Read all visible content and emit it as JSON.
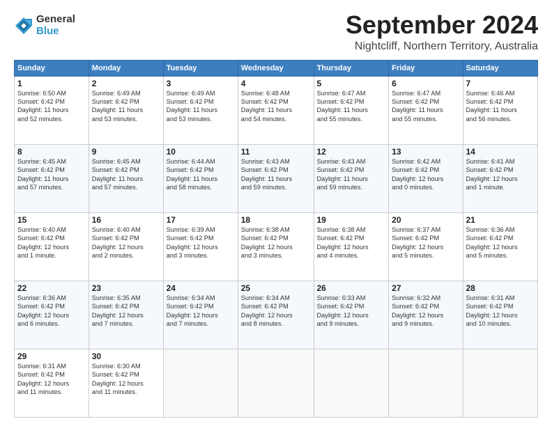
{
  "header": {
    "logo_general": "General",
    "logo_blue": "Blue",
    "month": "September 2024",
    "location": "Nightcliff, Northern Territory, Australia"
  },
  "calendar": {
    "days_of_week": [
      "Sunday",
      "Monday",
      "Tuesday",
      "Wednesday",
      "Thursday",
      "Friday",
      "Saturday"
    ],
    "weeks": [
      [
        {
          "day": "1",
          "info": "Sunrise: 6:50 AM\nSunset: 6:42 PM\nDaylight: 11 hours\nand 52 minutes."
        },
        {
          "day": "2",
          "info": "Sunrise: 6:49 AM\nSunset: 6:42 PM\nDaylight: 11 hours\nand 53 minutes."
        },
        {
          "day": "3",
          "info": "Sunrise: 6:49 AM\nSunset: 6:42 PM\nDaylight: 11 hours\nand 53 minutes."
        },
        {
          "day": "4",
          "info": "Sunrise: 6:48 AM\nSunset: 6:42 PM\nDaylight: 11 hours\nand 54 minutes."
        },
        {
          "day": "5",
          "info": "Sunrise: 6:47 AM\nSunset: 6:42 PM\nDaylight: 11 hours\nand 55 minutes."
        },
        {
          "day": "6",
          "info": "Sunrise: 6:47 AM\nSunset: 6:42 PM\nDaylight: 11 hours\nand 55 minutes."
        },
        {
          "day": "7",
          "info": "Sunrise: 6:46 AM\nSunset: 6:42 PM\nDaylight: 11 hours\nand 56 minutes."
        }
      ],
      [
        {
          "day": "8",
          "info": "Sunrise: 6:45 AM\nSunset: 6:42 PM\nDaylight: 11 hours\nand 57 minutes."
        },
        {
          "day": "9",
          "info": "Sunrise: 6:45 AM\nSunset: 6:42 PM\nDaylight: 11 hours\nand 57 minutes."
        },
        {
          "day": "10",
          "info": "Sunrise: 6:44 AM\nSunset: 6:42 PM\nDaylight: 11 hours\nand 58 minutes."
        },
        {
          "day": "11",
          "info": "Sunrise: 6:43 AM\nSunset: 6:42 PM\nDaylight: 11 hours\nand 59 minutes."
        },
        {
          "day": "12",
          "info": "Sunrise: 6:43 AM\nSunset: 6:42 PM\nDaylight: 11 hours\nand 59 minutes."
        },
        {
          "day": "13",
          "info": "Sunrise: 6:42 AM\nSunset: 6:42 PM\nDaylight: 12 hours\nand 0 minutes."
        },
        {
          "day": "14",
          "info": "Sunrise: 6:41 AM\nSunset: 6:42 PM\nDaylight: 12 hours\nand 1 minute."
        }
      ],
      [
        {
          "day": "15",
          "info": "Sunrise: 6:40 AM\nSunset: 6:42 PM\nDaylight: 12 hours\nand 1 minute."
        },
        {
          "day": "16",
          "info": "Sunrise: 6:40 AM\nSunset: 6:42 PM\nDaylight: 12 hours\nand 2 minutes."
        },
        {
          "day": "17",
          "info": "Sunrise: 6:39 AM\nSunset: 6:42 PM\nDaylight: 12 hours\nand 3 minutes."
        },
        {
          "day": "18",
          "info": "Sunrise: 6:38 AM\nSunset: 6:42 PM\nDaylight: 12 hours\nand 3 minutes."
        },
        {
          "day": "19",
          "info": "Sunrise: 6:38 AM\nSunset: 6:42 PM\nDaylight: 12 hours\nand 4 minutes."
        },
        {
          "day": "20",
          "info": "Sunrise: 6:37 AM\nSunset: 6:42 PM\nDaylight: 12 hours\nand 5 minutes."
        },
        {
          "day": "21",
          "info": "Sunrise: 6:36 AM\nSunset: 6:42 PM\nDaylight: 12 hours\nand 5 minutes."
        }
      ],
      [
        {
          "day": "22",
          "info": "Sunrise: 6:36 AM\nSunset: 6:42 PM\nDaylight: 12 hours\nand 6 minutes."
        },
        {
          "day": "23",
          "info": "Sunrise: 6:35 AM\nSunset: 6:42 PM\nDaylight: 12 hours\nand 7 minutes."
        },
        {
          "day": "24",
          "info": "Sunrise: 6:34 AM\nSunset: 6:42 PM\nDaylight: 12 hours\nand 7 minutes."
        },
        {
          "day": "25",
          "info": "Sunrise: 6:34 AM\nSunset: 6:42 PM\nDaylight: 12 hours\nand 8 minutes."
        },
        {
          "day": "26",
          "info": "Sunrise: 6:33 AM\nSunset: 6:42 PM\nDaylight: 12 hours\nand 9 minutes."
        },
        {
          "day": "27",
          "info": "Sunrise: 6:32 AM\nSunset: 6:42 PM\nDaylight: 12 hours\nand 9 minutes."
        },
        {
          "day": "28",
          "info": "Sunrise: 6:31 AM\nSunset: 6:42 PM\nDaylight: 12 hours\nand 10 minutes."
        }
      ],
      [
        {
          "day": "29",
          "info": "Sunrise: 6:31 AM\nSunset: 6:42 PM\nDaylight: 12 hours\nand 11 minutes."
        },
        {
          "day": "30",
          "info": "Sunrise: 6:30 AM\nSunset: 6:42 PM\nDaylight: 12 hours\nand 11 minutes."
        },
        {
          "day": "",
          "info": ""
        },
        {
          "day": "",
          "info": ""
        },
        {
          "day": "",
          "info": ""
        },
        {
          "day": "",
          "info": ""
        },
        {
          "day": "",
          "info": ""
        }
      ]
    ]
  }
}
